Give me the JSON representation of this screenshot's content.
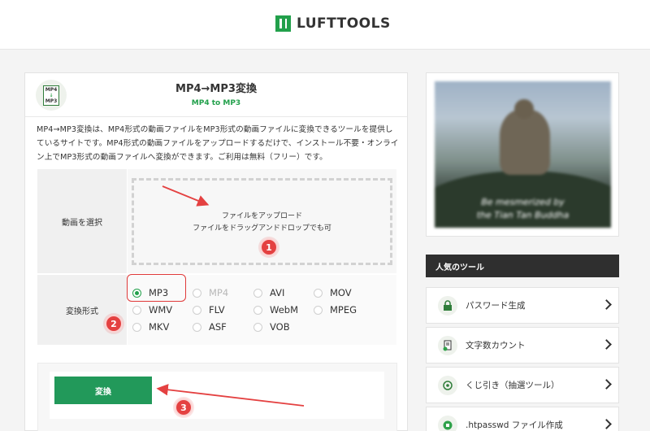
{
  "header": {
    "logo_text": "LUFTTOOLS"
  },
  "tool": {
    "icon_text_top": "MP4",
    "icon_text_mid": "↓",
    "icon_text_bottom": "MP3",
    "title": "MP4→MP3変換",
    "subtitle": "MP4 to MP3",
    "description": "MP4→MP3変換は、MP4形式の動画ファイルをMP3形式の動画ファイルに変換できるツールを提供しているサイトです。MP4形式の動画ファイルをアップロードするだけで、インストール不要・オンライン上でMP3形式の動画ファイルへ変換ができます。ご利用は無料（フリー）です。"
  },
  "upload": {
    "label": "動画を選択",
    "line1": "ファイルをアップロード",
    "line2": "ファイルをドラッグアンドドロップでも可"
  },
  "format": {
    "label": "変換形式",
    "selected": "MP3",
    "options": [
      "MP3",
      "MP4",
      "AVI",
      "MOV",
      "WMV",
      "FLV",
      "WebM",
      "MPEG",
      "MKV",
      "ASF",
      "VOB"
    ],
    "disabled": [
      "MP4"
    ]
  },
  "convert": {
    "label": "変換"
  },
  "annotations": {
    "badge1": "1",
    "badge2": "2",
    "badge3": "3",
    "color": "#e44141"
  },
  "sidebar": {
    "ad_caption_1": "Be mesmerized by",
    "ad_caption_2": "the Tian Tan Buddha",
    "popular_title": "人気のツール",
    "items": [
      {
        "label": "パスワード生成",
        "icon": "lock-icon"
      },
      {
        "label": "文字数カウント",
        "icon": "document-count-icon"
      },
      {
        "label": "くじ引き（抽選ツール）",
        "icon": "lottery-icon"
      },
      {
        "label": ".htpasswd ファイル作成",
        "icon": "key-file-icon"
      }
    ]
  },
  "colors": {
    "brand_green": "#22a04b",
    "button_green": "#22995a",
    "sidebar_dark": "#2f2f2f",
    "annotation_red": "#e44141"
  }
}
